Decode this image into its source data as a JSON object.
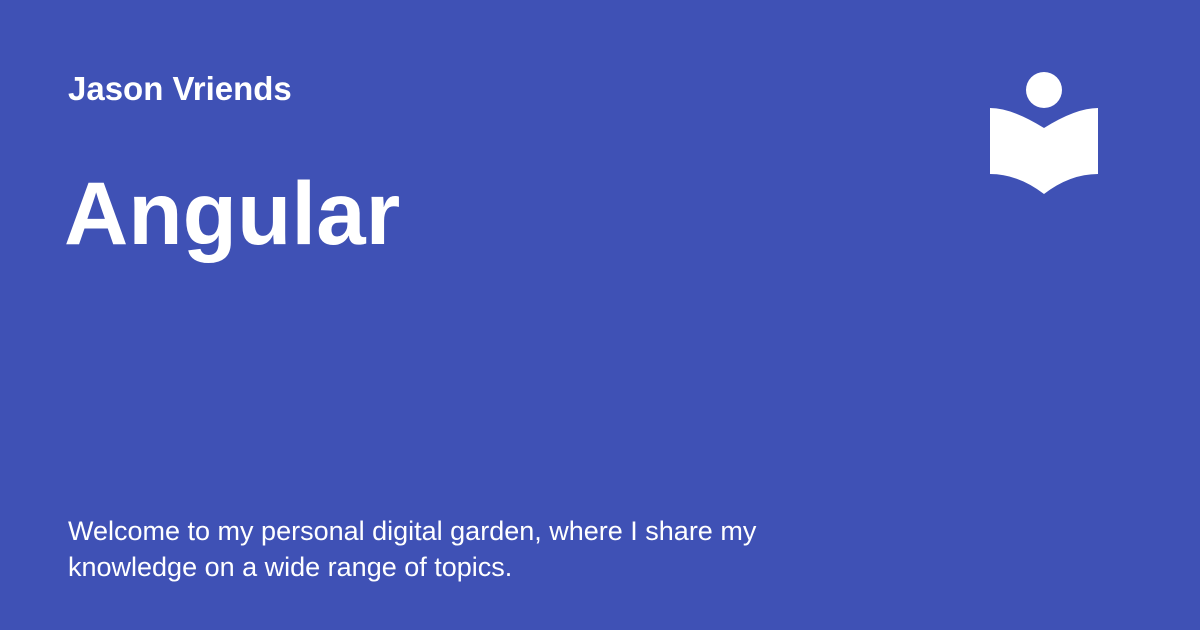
{
  "card": {
    "author": "Jason Vriends",
    "title": "Angular",
    "description": "Welcome to my personal digital garden, where I share my knowledge on a wide range of topics."
  },
  "logo": {
    "icon": "reader-book-icon"
  },
  "colors": {
    "background": "#3f51b5",
    "foreground": "#ffffff"
  }
}
